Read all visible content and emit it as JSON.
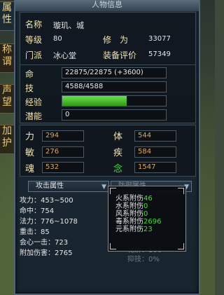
{
  "window": {
    "title": "人物信息"
  },
  "side_tabs": [
    "属性",
    "称谓",
    "声望",
    "加护"
  ],
  "profile": {
    "name_label": "名称",
    "name_value": "璇玑、城",
    "level_label": "等级",
    "level_value": "80",
    "cultivation_label": "修　为",
    "cultivation_value": "33077",
    "faction_label": "门派",
    "faction_value": "冰心堂",
    "gear_label": "装备评价",
    "gear_value": "57349"
  },
  "bars": {
    "hp_label": "命",
    "hp_text": "22875/22875 (+3600)",
    "skill_label": "技",
    "skill_text": "4588/4588",
    "exp_label": "经验",
    "exp_fill": 0.62,
    "potential_label": "潜能",
    "potential_text": "0"
  },
  "stats": {
    "str_label": "力",
    "str_value": "294",
    "con_label": "体",
    "con_value": "544",
    "agi_label": "敏",
    "agi_value": "276",
    "spd_label": "疾",
    "spd_value": "584",
    "soul_label": "魂",
    "soul_value": "532",
    "mind_label": "念",
    "mind_value": "1547"
  },
  "tabs": {
    "attack": "攻击属性",
    "defense": "防御属性"
  },
  "attack": [
    "攻力：453~500",
    "命中：754",
    "法力：776~1078",
    "重击：85",
    "会心一击：723",
    "附加伤害：2765"
  ],
  "defense": [
    {
      "label": "火系附伤",
      "value": "46"
    },
    {
      "label": "水系附伤",
      "value": "0"
    },
    {
      "label": "风系附伤",
      "value": "0"
    },
    {
      "label": "毒系附伤",
      "value": "2696"
    },
    {
      "label": "元系附伤",
      "value": "23"
    }
  ],
  "defense_faded": [
    "化解：106",
    "抑技：0%"
  ],
  "colors": {
    "hp": "#e8e8e8",
    "exp": "#52c734",
    "mind_label": "#40e040"
  }
}
